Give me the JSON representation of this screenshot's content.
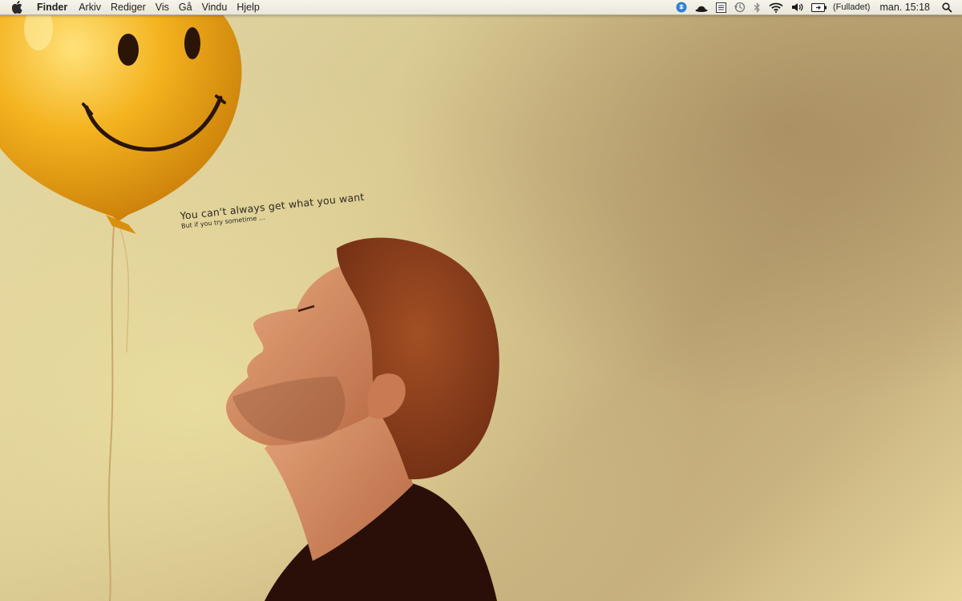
{
  "menubar": {
    "apple_icon": "apple-logo-icon",
    "app_name": "Finder",
    "menus": [
      "Arkiv",
      "Rediger",
      "Vis",
      "Gå",
      "Vindu",
      "Hjelp"
    ],
    "status_icons": [
      "dropbox-icon",
      "bowler-hat-icon",
      "notes-icon",
      "time-machine-icon",
      "bluetooth-icon",
      "wifi-icon",
      "volume-icon",
      "battery-icon"
    ],
    "battery_status": "(Fulladet)",
    "clock": "man. 15:18",
    "spotlight_icon": "spotlight-search-icon"
  },
  "wallpaper": {
    "quote_line1": "You can't always get what you want",
    "quote_line2": "But if you try sometime ...",
    "colors": {
      "balloon": "#f2b21c",
      "background_light": "#e4d9a8",
      "background_dark": "#b39c6c"
    }
  }
}
